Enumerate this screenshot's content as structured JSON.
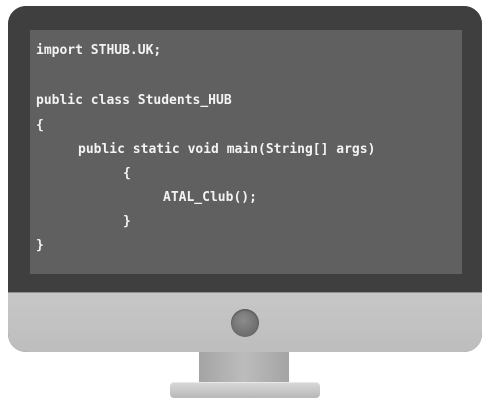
{
  "code": {
    "lines": [
      "import STHUB.UK;",
      "public class Students_HUB",
      "{",
      "public static void main(String[] args)",
      "{",
      "ATAL_Club();",
      "}",
      "}"
    ]
  },
  "colors": {
    "bezel": "#3f3f3f",
    "screen": "#606060",
    "code_text": "#f3f3f3",
    "chin": "#c3c3c3",
    "stand": "#b0b0b0"
  },
  "icons": {
    "power_button": "power-button-icon"
  }
}
